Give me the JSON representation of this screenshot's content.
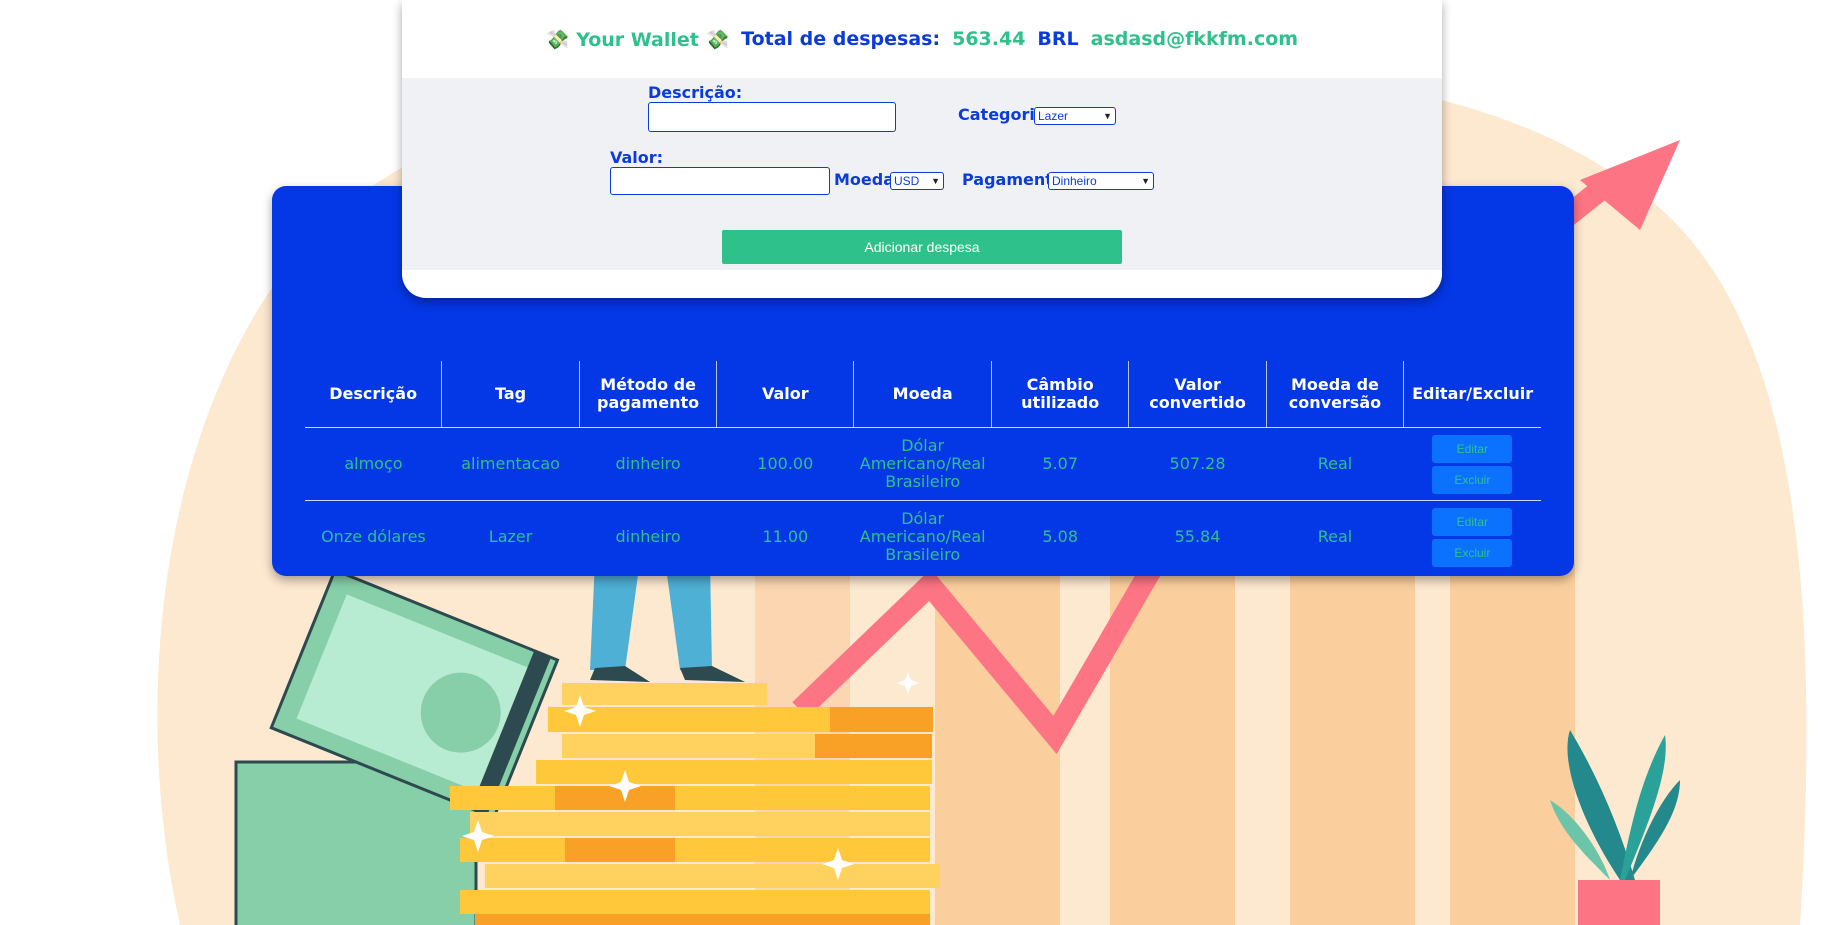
{
  "header": {
    "wallet_title": "💸 Your Wallet 💸",
    "total_label": "Total de despesas:",
    "total_value": "563.44",
    "currency": "BRL",
    "email": "asdasd@fkkfm.com"
  },
  "form": {
    "description_label": "Descrição:",
    "description_value": "",
    "category_label": "Categoria:",
    "category_selected": "Lazer",
    "value_label": "Valor:",
    "value_value": "",
    "currency_label": "Moeda:",
    "currency_selected": "USD",
    "payment_label": "Pagamento:",
    "payment_selected": "Dinheiro",
    "add_button": "Adicionar despesa"
  },
  "table": {
    "headers": [
      "Descrição",
      "Tag",
      "Método de pagamento",
      "Valor",
      "Moeda",
      "Câmbio utilizado",
      "Valor convertido",
      "Moeda de conversão",
      "Editar/Excluir"
    ],
    "rows": [
      {
        "descricao": "almoço",
        "tag": "alimentacao",
        "metodo": "dinheiro",
        "valor": "100.00",
        "moeda": "Dólar Americano/Real Brasileiro",
        "cambio": "5.07",
        "convertido": "507.28",
        "conversao": "Real",
        "edit_label": "Editar",
        "delete_label": "Excluir"
      },
      {
        "descricao": "Onze dólares",
        "tag": "Lazer",
        "metodo": "dinheiro",
        "valor": "11.00",
        "moeda": "Dólar Americano/Real Brasileiro",
        "cambio": "5.08",
        "convertido": "55.84",
        "conversao": "Real",
        "edit_label": "Editar",
        "delete_label": "Excluir"
      }
    ]
  },
  "colors": {
    "accent_green": "#2fc18c",
    "primary_blue": "#0437e6",
    "text_blue": "#0b3bd8",
    "button_blue": "#0a72ff"
  }
}
